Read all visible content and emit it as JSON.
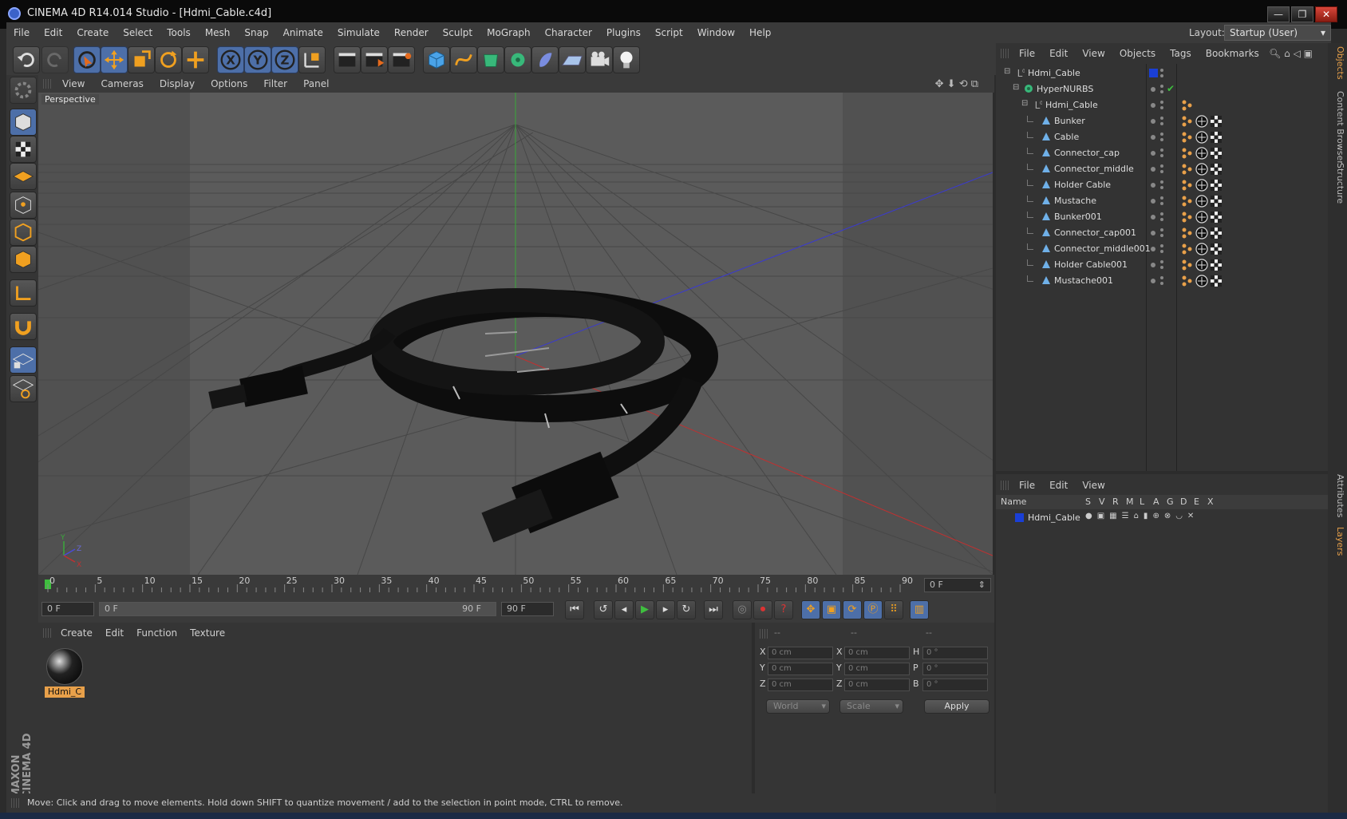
{
  "window": {
    "title": "CINEMA 4D R14.014 Studio - [Hdmi_Cable.c4d]",
    "minimize": "—",
    "restore": "❐",
    "close": "✕"
  },
  "menu": [
    "File",
    "Edit",
    "Create",
    "Select",
    "Tools",
    "Mesh",
    "Snap",
    "Animate",
    "Simulate",
    "Render",
    "Sculpt",
    "MoGraph",
    "Character",
    "Plugins",
    "Script",
    "Window",
    "Help"
  ],
  "layout": {
    "label": "Layout:",
    "value": "Startup (User)"
  },
  "viewport": {
    "menu": [
      "View",
      "Cameras",
      "Display",
      "Options",
      "Filter",
      "Panel"
    ],
    "label": "Perspective",
    "axis_y": "Y",
    "axis_x": "X",
    "axis_z": "Z"
  },
  "timeline": {
    "ticks": [
      "0",
      "5",
      "10",
      "15",
      "20",
      "25",
      "30",
      "35",
      "40",
      "45",
      "50",
      "55",
      "60",
      "65",
      "70",
      "75",
      "80",
      "85",
      "90"
    ],
    "current_frame": "0 F"
  },
  "playback": {
    "start": "0 F",
    "range_start": "0 F",
    "range_end": "90 F",
    "end": "90 F"
  },
  "material": {
    "menu": [
      "Create",
      "Edit",
      "Function",
      "Texture"
    ],
    "item_label": "Hdmi_C"
  },
  "coords": {
    "headers": [
      "--",
      "--",
      "--"
    ],
    "rows": [
      {
        "l1": "X",
        "v1": "0 cm",
        "l2": "X",
        "v2": "0 cm",
        "l3": "H",
        "v3": "0 °"
      },
      {
        "l1": "Y",
        "v1": "0 cm",
        "l2": "Y",
        "v2": "0 cm",
        "l3": "P",
        "v3": "0 °"
      },
      {
        "l1": "Z",
        "v1": "0 cm",
        "l2": "Z",
        "v2": "0 cm",
        "l3": "B",
        "v3": "0 °"
      }
    ],
    "mode": "World",
    "scale": "Scale",
    "apply": "Apply"
  },
  "status": "Move: Click and drag to move elements. Hold down SHIFT to quantize movement / add to the selection in point mode, CTRL to remove.",
  "objects": {
    "menu": [
      "File",
      "Edit",
      "View",
      "Objects",
      "Tags",
      "Bookmarks"
    ],
    "tree": [
      {
        "name": "Hdmi_Cable",
        "level": 0,
        "type": "null"
      },
      {
        "name": "HyperNURBS",
        "level": 1,
        "type": "nurbs"
      },
      {
        "name": "Hdmi_Cable",
        "level": 2,
        "type": "null"
      },
      {
        "name": "Bunker",
        "level": 3,
        "type": "mesh"
      },
      {
        "name": "Cable",
        "level": 3,
        "type": "mesh"
      },
      {
        "name": "Connector_cap",
        "level": 3,
        "type": "mesh"
      },
      {
        "name": "Connector_middle",
        "level": 3,
        "type": "mesh"
      },
      {
        "name": "Holder Cable",
        "level": 3,
        "type": "mesh"
      },
      {
        "name": "Mustache",
        "level": 3,
        "type": "mesh"
      },
      {
        "name": "Bunker001",
        "level": 3,
        "type": "mesh"
      },
      {
        "name": "Connector_cap001",
        "level": 3,
        "type": "mesh"
      },
      {
        "name": "Connector_middle001",
        "level": 3,
        "type": "mesh"
      },
      {
        "name": "Holder Cable001",
        "level": 3,
        "type": "mesh"
      },
      {
        "name": "Mustache001",
        "level": 3,
        "type": "mesh"
      }
    ]
  },
  "layers": {
    "menu": [
      "File",
      "Edit",
      "View"
    ],
    "columns": [
      "Name",
      "S",
      "V",
      "R",
      "M",
      "L",
      "A",
      "G",
      "D",
      "E",
      "X"
    ],
    "rows": [
      {
        "name": "Hdmi_Cable",
        "color": "#1a3fd6"
      }
    ]
  },
  "side_tabs": [
    "Objects",
    "Content Browser",
    "Structure",
    "Attributes",
    "Layers"
  ],
  "logo": {
    "line1": "MAXON",
    "line2": "CINEMA 4D"
  },
  "colors": {
    "accent": "#4d6fa8",
    "selection": "#e8a04a",
    "layer": "#1a3fd6"
  }
}
